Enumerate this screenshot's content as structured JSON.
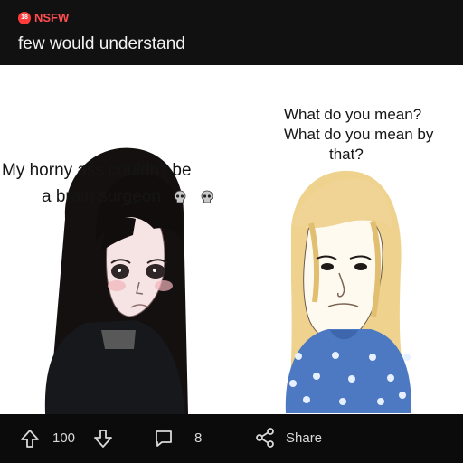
{
  "header": {
    "badge": "18",
    "nsfw_label": "NSFW",
    "title": "few would understand"
  },
  "meme": {
    "left_caption_line1": "My horny ass couldn't be",
    "left_caption_line2": "a brain surgeon",
    "right_caption_line1": "What do you mean?",
    "right_caption_line2": "What do you mean by",
    "right_caption_line3": "that?"
  },
  "footer": {
    "score": "100",
    "comments": "8",
    "share_label": "Share"
  },
  "icons": {
    "upvote": "arrow-up-icon",
    "downvote": "arrow-down-icon",
    "comment": "comment-icon",
    "share": "share-icon",
    "skull": "skull-icon"
  },
  "colors": {
    "accent": "#ff4d4f",
    "background": "#0b0b0b",
    "header": "#111111",
    "text": "#f2f2f2"
  }
}
